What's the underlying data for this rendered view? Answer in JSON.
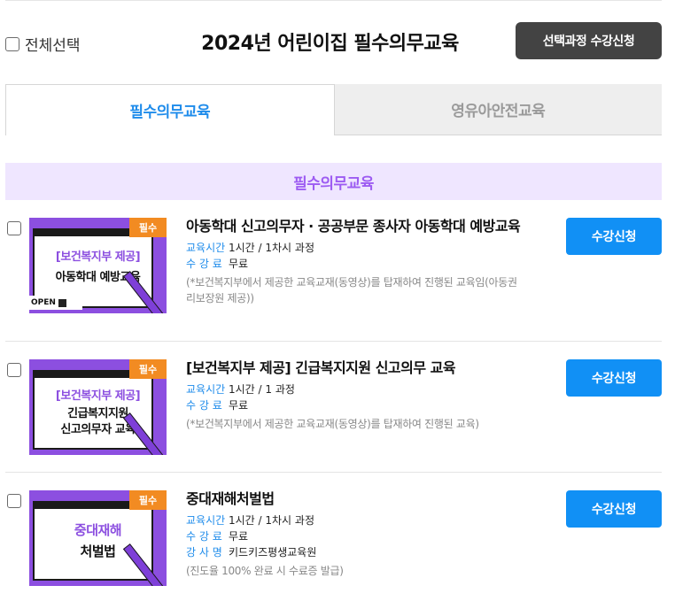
{
  "header": {
    "select_all_label": "전체선택",
    "title": "2024년 어린이집 필수의무교육",
    "apply_selected_label": "선택과정 수강신청"
  },
  "tabs": [
    {
      "label": "필수의무교육",
      "active": true
    },
    {
      "label": "영유아안전교육",
      "active": false
    }
  ],
  "section_title": "필수의무교육",
  "meta_labels": {
    "time": "교육시간",
    "fee": "수 강 료",
    "instructor": "강 사 명"
  },
  "courses": [
    {
      "title": "아동학대 신고의무자 · 공공부문 종사자 아동학대 예방교육",
      "time": "1시간 / 1차시 과정",
      "fee": "무료",
      "note": "(*보건복지부에서 제공한 교육교재(동영상)를 탑재하여 진행된 교육임(아동권리보장원 제공))",
      "badge": "필수",
      "thumb_line1": "[보건복지부 제공]",
      "thumb_line2": "아동학대 예방교육",
      "thumb_extra": "OPEN",
      "button": "수강신청"
    },
    {
      "title": "[보건복지부 제공] 긴급복지지원 신고의무 교육",
      "time": "1시간 / 1 과정",
      "fee": "무료",
      "note": "(*보건복지부에서 제공한 교육교재(동영상)를 탑재하여 진행된 교육)",
      "badge": "필수",
      "thumb_line1": "[보건복지부 제공]",
      "thumb_line2": "긴급복지지원",
      "thumb_line3": "신고의무자 교육",
      "button": "수강신청"
    },
    {
      "title": "중대재해처벌법",
      "time": "1시간 / 1차시 과정",
      "fee": "무료",
      "instructor": "키드키즈평생교육원",
      "note": "(진도율 100% 완료 시 수료증 발급)",
      "badge": "필수",
      "thumb_line1": "중대재해",
      "thumb_line2": "처벌법",
      "button": "수강신청"
    }
  ],
  "colors": {
    "accent_blue": "#1190f5",
    "tab_active_text": "#1f8ceb",
    "section_bg": "#efe6ff",
    "section_text": "#9d5cf2",
    "thumb_purple": "#8c4fe0",
    "badge_orange": "#f28b22",
    "dark_button": "#434343"
  }
}
